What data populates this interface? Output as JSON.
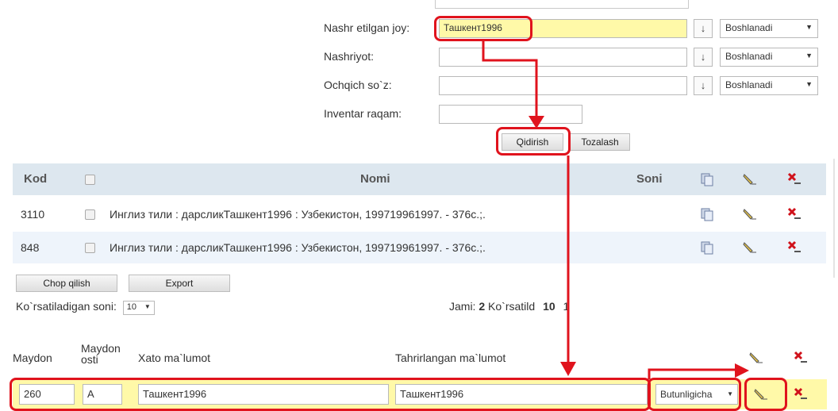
{
  "form": {
    "fields": [
      {
        "label": "Nashr etilgan joy:",
        "value": "Ташкент1996",
        "mode": "Boshlanadi"
      },
      {
        "label": "Nashriyot:",
        "value": "",
        "mode": "Boshlanadi"
      },
      {
        "label": "Ochqich so`z:",
        "value": "",
        "mode": "Boshlanadi"
      },
      {
        "label": "Inventar raqam:",
        "value": ""
      }
    ],
    "arrow_glyph": "↓",
    "search_button": "Qidirish",
    "clear_button": "Tozalash"
  },
  "table": {
    "headers": {
      "kod": "Kod",
      "nomi": "Nomi",
      "soni": "Soni"
    },
    "rows": [
      {
        "kod": "3110",
        "nomi": "Инглиз тили : дарсликТашкент1996 : Узбекистон, 199719961997. - 376с.;.",
        "soni": ""
      },
      {
        "kod": "848",
        "nomi": "Инглиз тили : дарсликТашкент1996 : Узбекистон, 199719961997. - 376с.;.",
        "soni": ""
      }
    ]
  },
  "actions": {
    "print": "Chop qilish",
    "export": "Export"
  },
  "pager": {
    "per_page_label": "Ko`rsatiladigan soni:",
    "per_page_value": "10",
    "total_label": "Jami:",
    "total_value": "2",
    "shown_label": "Ko`rsatild",
    "shown_value": "10",
    "page": "1"
  },
  "bottom": {
    "headers": {
      "maydon": "Maydon",
      "maydon_osti_1": "Maydon",
      "maydon_osti_2": "osti",
      "xato": "Xato ma`lumot",
      "tahrir": "Tahrirlangan ma`lumot"
    },
    "row": {
      "maydon": "260",
      "maydon_osti": "A",
      "xato": "Ташкент1996",
      "tahrir": "Ташкент1996",
      "mode": "Butunligicha"
    }
  },
  "colors": {
    "highlight": "#fff9a8",
    "annotation_red": "#e0131d",
    "table_header": "#dde7ef",
    "row_alt": "#eef4fb"
  },
  "icons": [
    "copy-icon",
    "edit-pencil-icon",
    "delete-icon",
    "dropdown-caret-icon"
  ]
}
